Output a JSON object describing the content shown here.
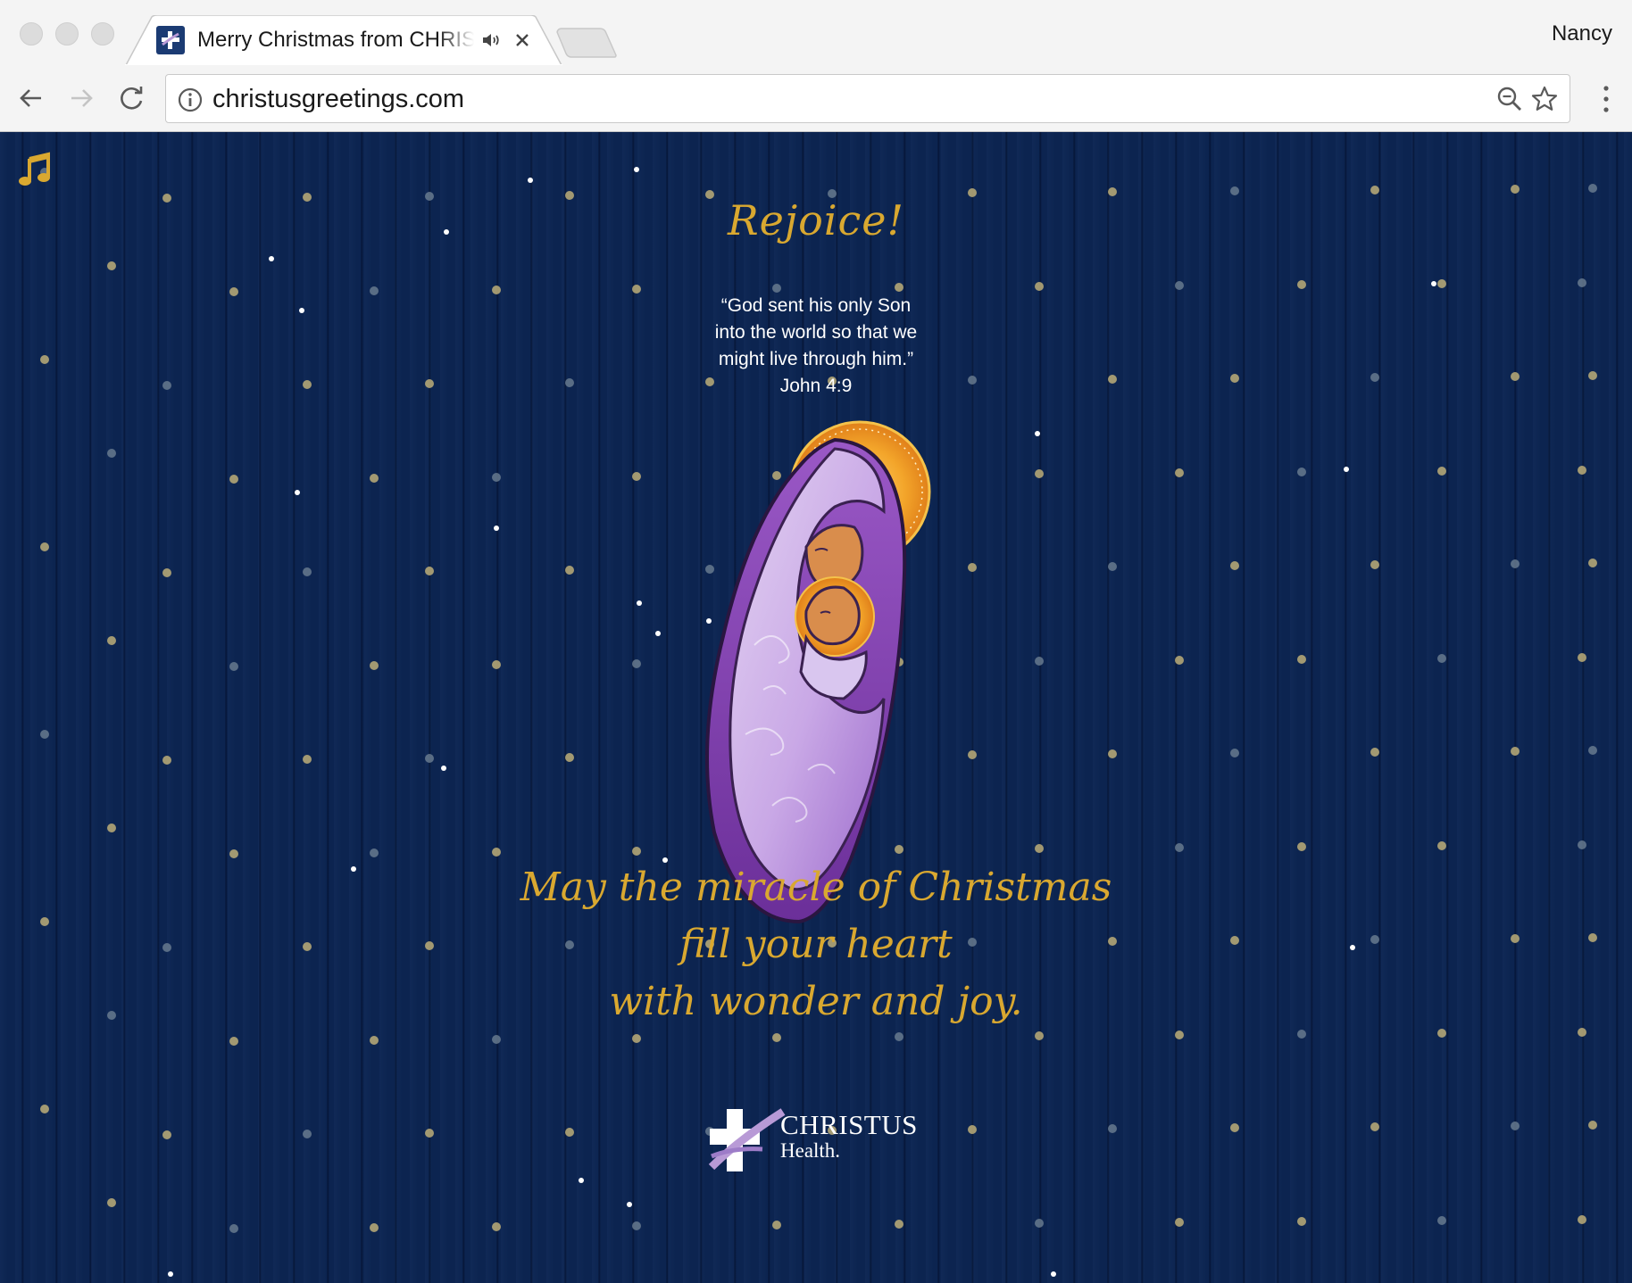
{
  "browser": {
    "tab": {
      "title": "Merry Christmas from CHRISTUS Health",
      "audio": "speaker-icon",
      "close": "close-icon"
    },
    "profile_name": "Nancy",
    "address_bar": {
      "url": "christusgreetings.com",
      "site_info_icon": "info-icon",
      "zoom_icon": "zoom-out-icon",
      "bookmark_icon": "star-icon"
    },
    "nav": {
      "back": "back-arrow-icon",
      "forward": "forward-arrow-icon",
      "reload": "reload-icon",
      "menu": "vertical-dots-icon"
    }
  },
  "page": {
    "colors": {
      "background": "#0c2450",
      "gold": "#d9a830",
      "white": "#ffffff",
      "purple": "#7b3fa6",
      "lavender": "#c9a8e6"
    },
    "music_toggle_icon": "music-note-icon",
    "heading": "Rejoice!",
    "verse": {
      "lines": [
        "“God sent his only Son",
        "into the world so that we",
        "might live through him.”"
      ],
      "reference": "John 4:9"
    },
    "illustration": "nativity-mary-and-child-illustration",
    "blessing": {
      "lines": [
        "May the miracle of Christmas",
        "fill your heart",
        "with wonder and joy."
      ]
    },
    "logo": {
      "name": "CHRISTUS",
      "sub": "Health."
    }
  }
}
